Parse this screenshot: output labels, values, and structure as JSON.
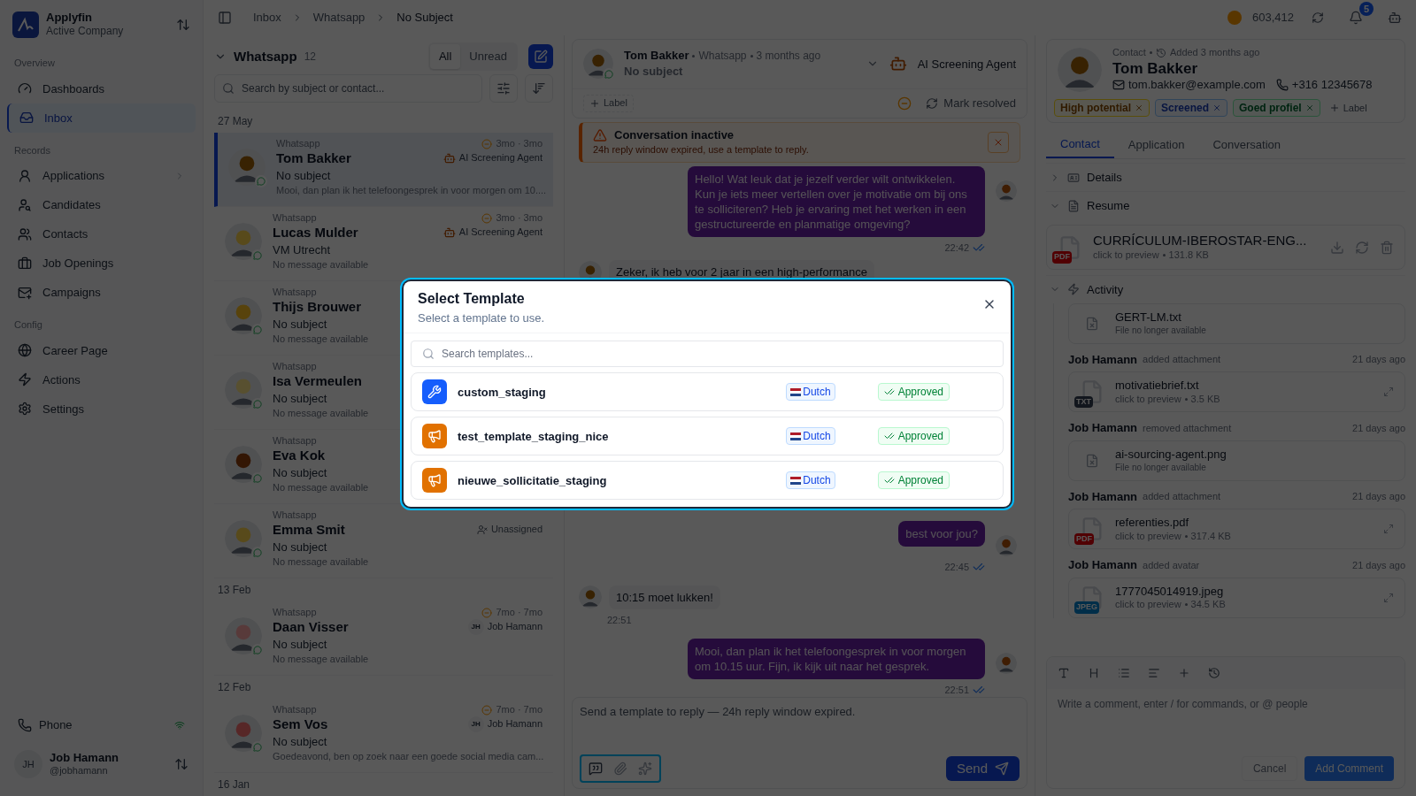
{
  "sidebar": {
    "brand": {
      "name": "Applyfin",
      "subtitle": "Active Company"
    },
    "sections": [
      {
        "title": "Overview",
        "items": [
          {
            "label": "Dashboards",
            "selected": false,
            "has_submenu": false
          },
          {
            "label": "Inbox",
            "selected": true,
            "has_submenu": false
          }
        ]
      },
      {
        "title": "Records",
        "items": [
          {
            "label": "Applications",
            "selected": false,
            "has_submenu": true
          },
          {
            "label": "Candidates",
            "selected": false,
            "has_submenu": false
          },
          {
            "label": "Contacts",
            "selected": false,
            "has_submenu": false
          },
          {
            "label": "Job Openings",
            "selected": false,
            "has_submenu": false
          },
          {
            "label": "Campaigns",
            "selected": false,
            "has_submenu": false
          }
        ]
      },
      {
        "title": "Config",
        "items": [
          {
            "label": "Career Page",
            "selected": false,
            "has_submenu": false
          },
          {
            "label": "Actions",
            "selected": false,
            "has_submenu": false
          },
          {
            "label": "Settings",
            "selected": false,
            "has_submenu": false
          }
        ]
      }
    ],
    "phone": "Phone",
    "user": {
      "initials": "JH",
      "name": "Job Hamann",
      "handle": "@jobhamann"
    }
  },
  "breadcrumb": [
    "Inbox",
    "Whatsapp",
    "No Subject"
  ],
  "topbar": {
    "credits": "603,412",
    "notifications": "5"
  },
  "list": {
    "title": "Whatsapp",
    "count": "12",
    "filters": [
      {
        "label": "All",
        "selected": true
      },
      {
        "label": "Unread",
        "selected": false
      }
    ],
    "search_placeholder": "Search by subject or contact...",
    "groups": [
      {
        "date": "27 May",
        "conversations": [
          {
            "channel": "Whatsapp",
            "name": "Tom Bakker",
            "subject": "No subject",
            "preview": "Mooi, dan plan ik het telefoongesprek in voor morgen om 10....",
            "time": "3mo · 3mo",
            "assignee": {
              "kind": "agent",
              "name": "AI Screening Agent"
            },
            "selected": true
          },
          {
            "channel": "Whatsapp",
            "name": "Lucas Mulder",
            "subject": "VM Utrecht",
            "preview": "No message available",
            "time": "3mo · 3mo",
            "assignee": {
              "kind": "agent",
              "name": "AI Screening Agent"
            },
            "selected": false
          },
          {
            "channel": "Whatsapp",
            "name": "Thijs Brouwer",
            "subject": "No subject",
            "preview": "No message available",
            "selected": false
          },
          {
            "channel": "Whatsapp",
            "name": "Isa Vermeulen",
            "subject": "No subject",
            "preview": "No message available",
            "selected": false
          },
          {
            "channel": "Whatsapp",
            "name": "Eva Kok",
            "subject": "No subject",
            "preview": "No message available",
            "selected": false
          },
          {
            "channel": "Whatsapp",
            "name": "Emma Smit",
            "subject": "No subject",
            "preview": "No message available",
            "assignee": {
              "kind": "unassigned",
              "name": "Unassigned"
            },
            "selected": false
          }
        ]
      },
      {
        "date": "13 Feb",
        "conversations": [
          {
            "channel": "Whatsapp",
            "name": "Daan Visser",
            "subject": "No subject",
            "preview": "No message available",
            "time": "7mo · 7mo",
            "assignee": {
              "kind": "user",
              "name": "Job Hamann",
              "initials": "JH"
            },
            "selected": false
          }
        ]
      },
      {
        "date": "12 Feb",
        "conversations": [
          {
            "channel": "Whatsapp",
            "name": "Sem Vos",
            "subject": "No subject",
            "preview": "Goedeavond, ben op zoek naar een goede social media cam...",
            "time": "7mo · 7mo",
            "assignee": {
              "kind": "user",
              "name": "Job Hamann",
              "initials": "JH"
            },
            "selected": false
          }
        ]
      }
    ],
    "trailing_date": "16 Jan"
  },
  "chat": {
    "name": "Tom Bakker",
    "channel": "Whatsapp",
    "time": "3 months ago",
    "subject": "No subject",
    "agent": "AI Screening Agent",
    "label_button": "Label",
    "resolve_button": "Mark resolved",
    "alert": {
      "title": "Conversation inactive",
      "text": "24h reply window expired, use a template to reply."
    },
    "messages_top": [
      {
        "kind": "outgoing",
        "text": "Hello! Wat leuk dat je jezelf verder wilt ontwikkelen. Kun je iets meer vertellen over je motivatie om bij ons te solliciteren? Heb je ervaring met het werken in een gestructureerde en planmatige omgeving?",
        "time": "22:42"
      },
      {
        "kind": "incoming",
        "text": "Zeker, ik heb voor 2 jaar in een high-performance"
      }
    ],
    "messages_bottom": [
      {
        "kind": "outgoing",
        "text": "best voor jou?",
        "time": "22:45"
      },
      {
        "kind": "incoming",
        "text": "10:15 moet lukken!",
        "time": "22:51"
      },
      {
        "kind": "outgoing",
        "text": "Mooi, dan plan ik het telefoongesprek in voor morgen om 10.15 uur. Fijn, ik kijk uit naar het gesprek.",
        "time": "22:51"
      }
    ],
    "composer_placeholder": "Send a template to reply — 24h reply window expired.",
    "send": "Send"
  },
  "contact": {
    "kind": "Contact",
    "added": "Added 3 months ago",
    "name": "Tom Bakker",
    "email": "tom.bakker@example.com",
    "phone": "+316 12345678",
    "tags": [
      {
        "label": "High potential",
        "kind": "warning"
      },
      {
        "label": "Screened",
        "kind": "info"
      },
      {
        "label": "Goed profiel",
        "kind": "success"
      }
    ],
    "add_label": "Label",
    "tabs": [
      {
        "label": "Contact",
        "selected": true
      },
      {
        "label": "Application",
        "selected": false
      },
      {
        "label": "Conversation",
        "selected": false
      }
    ],
    "details": {
      "title": "Details",
      "expanded": false
    },
    "resume": {
      "title": "Resume",
      "expanded": true,
      "file": {
        "name": "CURRÍCULUM-IBEROSTAR-ENG...",
        "available": true,
        "type": "PDF",
        "kind": "pdf",
        "preview": "click to preview",
        "size": "131.8 KB"
      }
    },
    "activity": {
      "title": "Activity",
      "expanded": true,
      "items": [
        {
          "file": {
            "name": "GERT-LM.txt",
            "available": false,
            "status": "File no longer available"
          }
        },
        {
          "actor": "Job Hamann",
          "action": "added attachment",
          "time": "21 days ago",
          "file": {
            "name": "motivatiebrief.txt",
            "available": true,
            "type": "TXT",
            "kind": "text",
            "preview": "click to preview",
            "size": "3.5 KB"
          }
        },
        {
          "actor": "Job Hamann",
          "action": "removed attachment",
          "time": "21 days ago",
          "file": {
            "name": "ai-sourcing-agent.png",
            "available": false,
            "status": "File no longer available"
          }
        },
        {
          "actor": "Job Hamann",
          "action": "added attachment",
          "time": "21 days ago",
          "file": {
            "name": "referenties.pdf",
            "available": true,
            "type": "PDF",
            "kind": "pdf",
            "preview": "click to preview",
            "size": "317.4 KB"
          }
        },
        {
          "actor": "Job Hamann",
          "action": "added avatar",
          "time": "21 days ago",
          "file": {
            "name": "1777045014919.jpeg",
            "available": true,
            "type": "JPEG",
            "kind": "image",
            "preview": "click to preview",
            "size": "34.5 KB"
          }
        }
      ]
    },
    "comment": {
      "placeholder": "Write a comment, enter / for commands, or @ people",
      "cancel": "Cancel",
      "submit": "Add Comment"
    }
  },
  "modal": {
    "title": "Select Template",
    "subtitle": "Select a template to use.",
    "search_placeholder": "Search templates...",
    "templates": [
      {
        "name": "custom_staging",
        "kind": "utility",
        "language": "Dutch",
        "status": "Approved"
      },
      {
        "name": "test_template_staging_nice",
        "kind": "marketing",
        "language": "Dutch",
        "status": "Approved"
      },
      {
        "name": "nieuwe_sollicitatie_staging",
        "kind": "marketing",
        "language": "Dutch",
        "status": "Approved"
      }
    ]
  }
}
